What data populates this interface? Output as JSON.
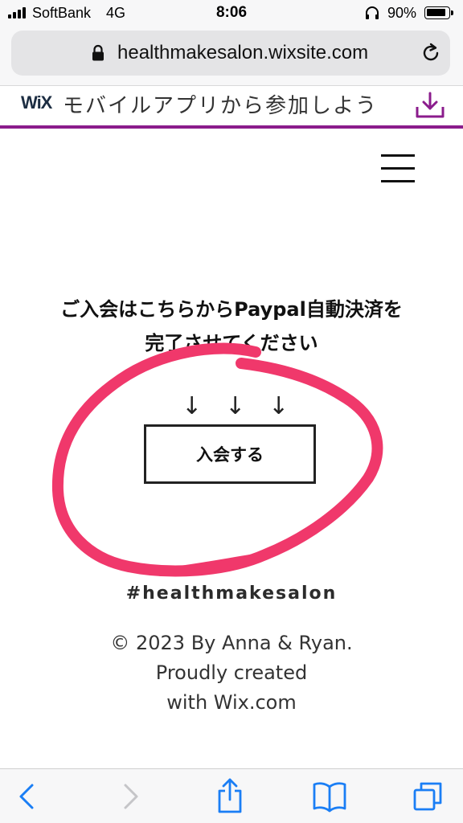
{
  "status_bar": {
    "carrier": "SoftBank",
    "network": "4G",
    "time": "8:06",
    "battery_percent": "90%",
    "battery_level": 0.9
  },
  "address_bar": {
    "url": "healthmakesalon.wixsite.com"
  },
  "wix_banner": {
    "logo": "WiX",
    "text": "モバイルアプリから参加しよう"
  },
  "page": {
    "headline_line1": "ご入会はこちらからPaypal自動決済を",
    "headline_line2": "完了させてください",
    "arrows": [
      "↓",
      "↓",
      "↓"
    ],
    "join_button_label": "入会する",
    "hashtag": "#healthmakesalon",
    "footer_line1": "© 2023 By Anna & Ryan.",
    "footer_line2": "Proudly created",
    "footer_line3": "with Wix.com"
  },
  "colors": {
    "accent_purple": "#8b1c8c",
    "annotation_pink": "#f0386b",
    "ios_blue": "#1a7ef5"
  },
  "toolbar": {
    "icons": [
      "back-icon",
      "forward-icon",
      "share-icon",
      "bookmarks-icon",
      "tabs-icon"
    ]
  }
}
